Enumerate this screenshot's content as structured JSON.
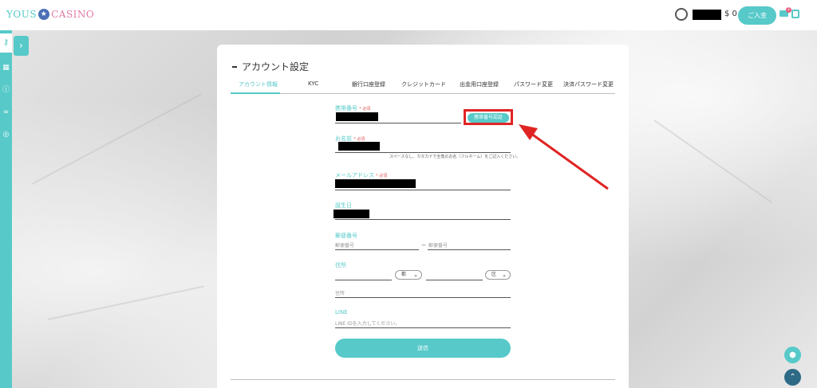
{
  "header": {
    "logo_left": "YOUS",
    "logo_right": "CASINO",
    "balance": "$ 0",
    "deposit_label": "ご入金",
    "mail_badge": "2"
  },
  "sidebar": {
    "items": [
      "key-icon",
      "grid-icon",
      "info-icon",
      "link-icon",
      "globe-icon"
    ]
  },
  "page": {
    "title": "アカウント設定",
    "tabs": [
      {
        "label": "アカウント情報",
        "active": true
      },
      {
        "label": "KYC"
      },
      {
        "label": "銀行口座登録"
      },
      {
        "label": "クレジットカード"
      },
      {
        "label": "出金用口座登録"
      },
      {
        "label": "パスワード変更"
      },
      {
        "label": "決済パスワード変更"
      }
    ]
  },
  "form": {
    "phone": {
      "label": "携帯番号",
      "required": "* 必須",
      "verify_button": "携帯番号認証"
    },
    "name": {
      "label": "お名前",
      "required": "* 必須",
      "hint": "スペースなし、カタカナで全角のお名（フルネーム）をご記入ください。"
    },
    "email": {
      "label": "メールアドレス",
      "required": "* 必須"
    },
    "birthday": {
      "label": "誕生日"
    },
    "postal": {
      "label": "郵便番号",
      "placeholder1": "郵便番号",
      "separator": "ー",
      "placeholder2": "郵便番号"
    },
    "address": {
      "label": "住所",
      "select1": "都",
      "select2": "区",
      "placeholder": "住所"
    },
    "line": {
      "label": "LINE",
      "placeholder": "LINE IDを入力してください。"
    },
    "submit_label": "送信"
  },
  "colors": {
    "accent": "#57c9c9",
    "highlight": "#e02424",
    "required": "#e05656"
  }
}
